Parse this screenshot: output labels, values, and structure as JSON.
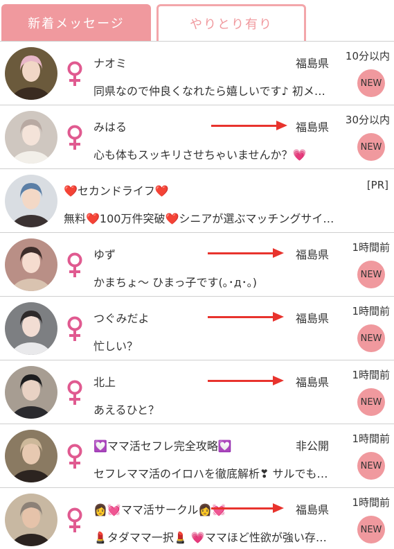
{
  "tabs": {
    "active": "新着メッセージ",
    "inactive": "やりとり有り"
  },
  "rows": [
    {
      "name": "ナオミ",
      "location": "福島県",
      "time": "10分以内",
      "message": "同県なので仲良くなれたら嬉しいです♪ 初メ…",
      "badge": "NEW",
      "arrow": false
    },
    {
      "name": "みはる",
      "location": "福島県",
      "time": "30分以内",
      "message": "心も体もスッキリさせちゃいませんか？💗",
      "badge": "NEW",
      "arrow": true
    },
    {
      "name": "❤️セカンドライフ❤️",
      "tag": "[PR]",
      "message": "無料❤️100万件突破❤️シニアが選ぶマッチングサイ…",
      "ad": true
    },
    {
      "name": "ゆず",
      "location": "福島県",
      "time": "1時間前",
      "message": "かまちょ～ ひまっ子です(｡･д･｡)",
      "badge": "NEW",
      "arrow": true
    },
    {
      "name": "つぐみだよ",
      "location": "福島県",
      "time": "1時間前",
      "message": "忙しい？",
      "badge": "NEW",
      "arrow": true
    },
    {
      "name": "北上",
      "location": "福島県",
      "time": "1時間前",
      "message": "あえるひと？",
      "badge": "NEW",
      "arrow": true
    },
    {
      "name": "💟ママ活セフレ完全攻略💟",
      "location": "非公開",
      "time": "1時間前",
      "message": "セフレママ活のイロハを徹底解析❣ サルでも…",
      "badge": "NEW",
      "arrow": false
    },
    {
      "name": "👩💓ママ活サークル👩💓",
      "location": "福島県",
      "time": "1時間前",
      "message": "💄タダママ一択💄 💗ママほど性欲が強い存…",
      "badge": "NEW",
      "arrow": true
    }
  ],
  "colors": {
    "tab_pink": "#f0999e",
    "female_icon": "#e05a90",
    "arrow_red": "#e8332d",
    "new_badge": "#f0999e"
  },
  "icons": {
    "gender": "female-symbol-icon",
    "arrow": "right-arrow-annotation"
  }
}
